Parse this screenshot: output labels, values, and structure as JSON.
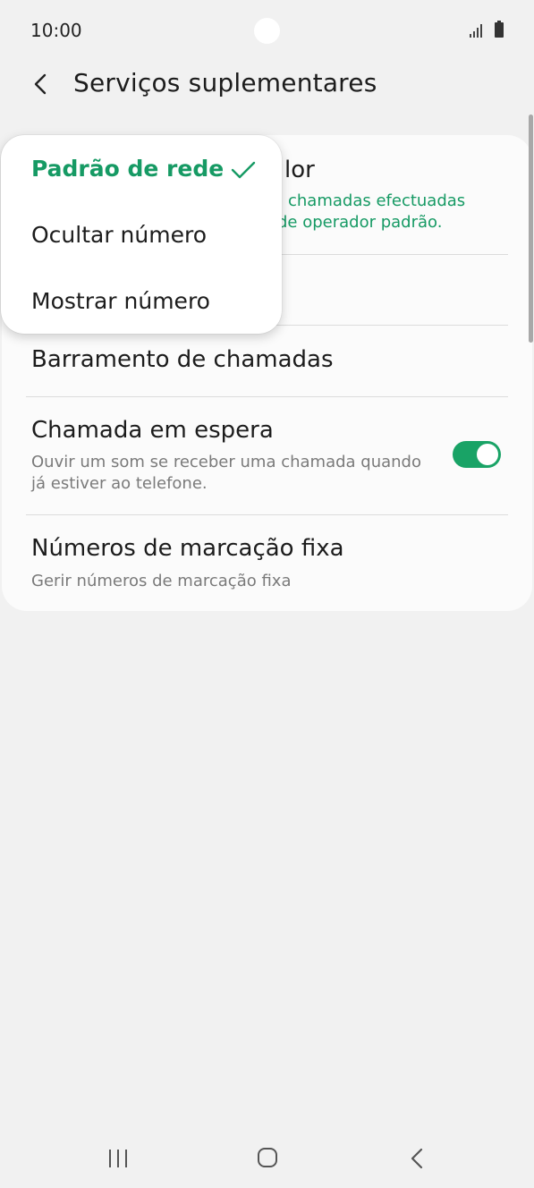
{
  "status_bar": {
    "time": "10:00"
  },
  "header": {
    "title": "Serviços suplementares",
    "back_icon": "chevron-left-icon"
  },
  "settings": {
    "caller_id": {
      "title_visible": "lor",
      "sub_line1_visible": "chamadas efectuadas",
      "sub_line2_visible": "de operador padrão."
    },
    "call_barring": {
      "title": "Barramento de chamadas"
    },
    "call_waiting": {
      "title": "Chamada em espera",
      "subtitle_line1": "Ouvir um som se receber uma chamada quando",
      "subtitle_line2": "já estiver ao telefone.",
      "enabled": true
    },
    "fixed_dialing": {
      "title": "Números de marcação fixa",
      "subtitle": "Gerir números de marcação fixa"
    }
  },
  "popup": {
    "options": [
      {
        "label": "Padrão de rede",
        "selected": true
      },
      {
        "label": "Ocultar número",
        "selected": false
      },
      {
        "label": "Mostrar número",
        "selected": false
      }
    ]
  },
  "colors": {
    "accent": "#169a64",
    "background": "#f1f1f1",
    "card": "#fbfbfb"
  }
}
